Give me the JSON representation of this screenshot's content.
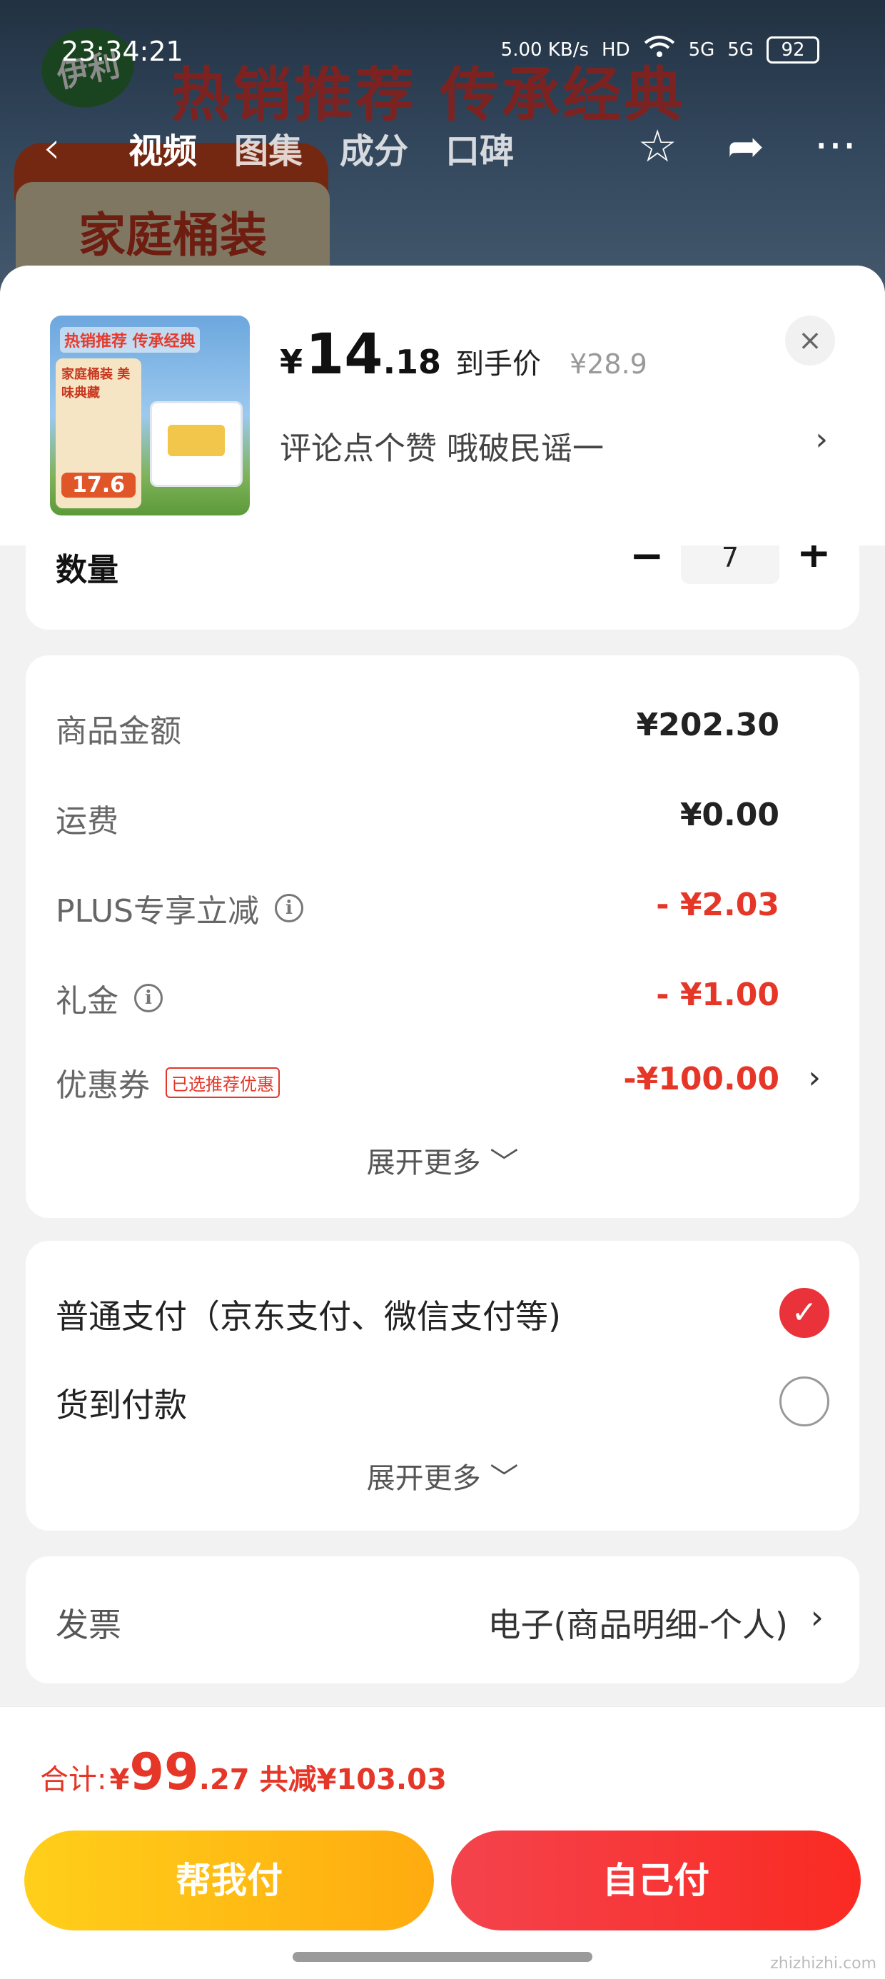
{
  "status_bar": {
    "time": "23:34:21",
    "net_speed": "5.00 KB/s",
    "hd": "HD",
    "signal1": "5G",
    "signal2": "5G",
    "battery": "92"
  },
  "background_page": {
    "brand": "伊利",
    "banner": "热销推荐 传承经典",
    "family_label": "家庭桶装",
    "tabs": [
      "视频",
      "图集",
      "成分",
      "口碑"
    ],
    "active_tab_index": 0
  },
  "product": {
    "image_title": "热销推荐 传承经典",
    "image_card_line": "家庭桶装 美味典藏",
    "image_price": "17.6",
    "price_symbol": "¥",
    "price_int": "14",
    "price_dec": ".18",
    "price_tag": "到手价",
    "original_price": "¥28.9",
    "spec": "评论点个赞  哦破民谣一",
    "close_icon": "×"
  },
  "quantity": {
    "label": "数量",
    "minus": "−",
    "value": "7",
    "plus": "+"
  },
  "fees": {
    "rows": [
      {
        "label": "商品金额",
        "value": "¥202.30",
        "red": false,
        "info": false
      },
      {
        "label": "运费",
        "value": "¥0.00",
        "red": false,
        "info": false
      },
      {
        "label": "PLUS专享立减",
        "value": "- ¥2.03",
        "red": true,
        "info": true
      },
      {
        "label": "礼金",
        "value": "- ¥1.00",
        "red": true,
        "info": true
      },
      {
        "label": "优惠券",
        "value": "-¥100.00",
        "red": true,
        "info": false,
        "tag": "已选推荐优惠"
      }
    ],
    "expand": "展开更多 ﹀"
  },
  "payment": {
    "options": [
      {
        "label": "普通支付（京东支付、微信支付等)",
        "checked": true
      },
      {
        "label": "货到付款",
        "checked": false
      }
    ],
    "expand": "展开更多 ﹀"
  },
  "invoice": {
    "label": "发票",
    "value": "电子(商品明细-个人)"
  },
  "total": {
    "label": "合计:",
    "symbol": "¥",
    "int": "99",
    "dec": ".27",
    "saved": "共减¥103.03"
  },
  "actions": {
    "help_pay": "帮我付",
    "self_pay": "自己付"
  },
  "watermark": "zhizhizhi.com",
  "colors": {
    "accent_red": "#e53628",
    "pay_red": "#fa2a22",
    "help_yellow": "#ffab0f"
  }
}
